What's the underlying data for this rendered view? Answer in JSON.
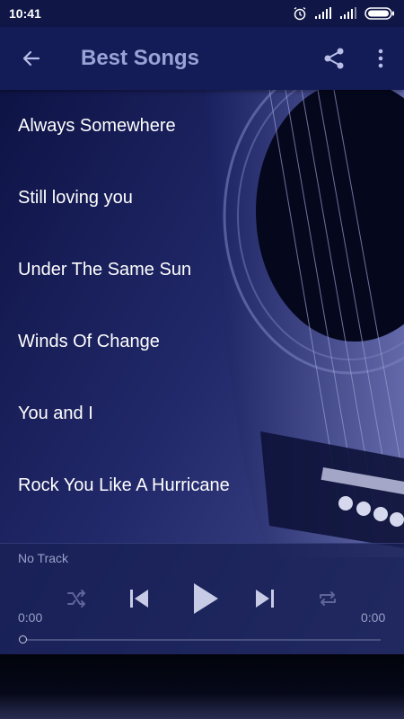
{
  "status_bar": {
    "time": "10:41",
    "icons": [
      "alarm-icon",
      "signal-icon",
      "signal-icon",
      "battery-icon"
    ]
  },
  "app_bar": {
    "title": "Best Songs",
    "back_icon": "arrow-back-icon",
    "share_icon": "share-icon",
    "more_icon": "more-vert-icon"
  },
  "songs": [
    {
      "title": "Always Somewhere"
    },
    {
      "title": "Still loving you"
    },
    {
      "title": "Under The Same Sun"
    },
    {
      "title": "Winds Of Change"
    },
    {
      "title": "You and I"
    },
    {
      "title": "Rock You Like A Hurricane"
    }
  ],
  "player": {
    "track_name": "No Track",
    "elapsed": "0:00",
    "duration": "0:00",
    "progress": 0,
    "controls": [
      "shuffle-icon",
      "skip-previous-icon",
      "play-icon",
      "skip-next-icon",
      "repeat-icon"
    ]
  },
  "colors": {
    "app_bar": "#141c58",
    "status_bar": "#101747",
    "title_text": "#9aa3d6",
    "song_text": "#ffffff"
  }
}
